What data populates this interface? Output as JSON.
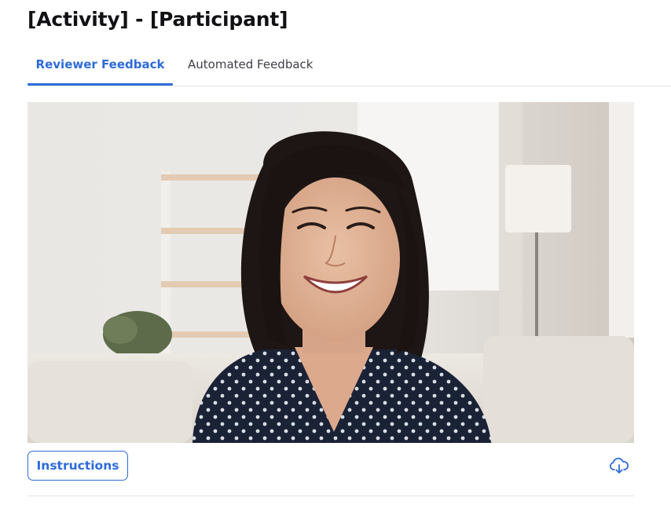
{
  "page": {
    "title": "[Activity] - [Participant]"
  },
  "tabs": [
    {
      "label": "Reviewer Feedback",
      "active": true
    },
    {
      "label": "Automated Feedback",
      "active": false
    }
  ],
  "media": {
    "icon": "video-thumbnail"
  },
  "actions": {
    "instructions_label": "Instructions",
    "download_icon": "cloud-download-icon"
  },
  "colors": {
    "accent": "#2e6bd9",
    "divider": "#e4e6ea",
    "title": "#111114"
  }
}
